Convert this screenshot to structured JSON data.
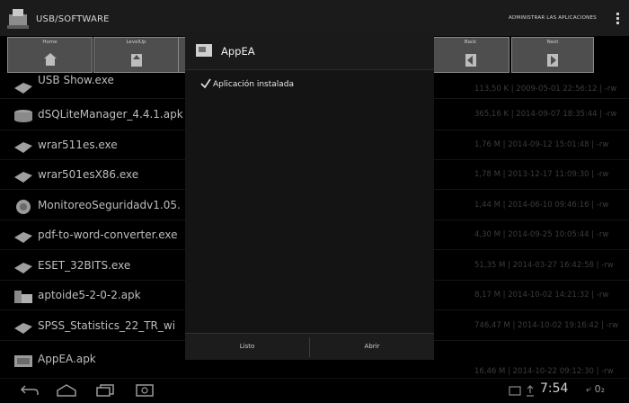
{
  "header": {
    "title": "USB/SOFTWARE",
    "manage_apps": "ADMINISTRAR LAS APLICACIONES"
  },
  "toolbar": {
    "home": "Home",
    "level_up": "LevelUp",
    "back": "Back",
    "next": "Next"
  },
  "files": [
    {
      "name": "USB Show.exe",
      "meta": "113,50 K | 2009-05-01 22:56:12 | -rw"
    },
    {
      "name": "dSQLiteManager_4.4.1.apk",
      "meta": "365,16 K | 2014-09-07 18:35:44 | -rw"
    },
    {
      "name": "wrar511es.exe",
      "meta": "1,76 M | 2014-09-12 15:01:48 | -rw"
    },
    {
      "name": "wrar501esX86.exe",
      "meta": "1,78 M | 2013-12-17 11:09:30 | -rw"
    },
    {
      "name": "MonitoreoSeguridadv1.05.",
      "meta": "1,44 M | 2014-06-10 09:46:16 | -rw"
    },
    {
      "name": "pdf-to-word-converter.exe",
      "meta": "4,30 M | 2014-09-25 10:05:44 | -rw"
    },
    {
      "name": "ESET_32BITS.exe",
      "meta": "51,35 M | 2014-03-27 16:42:58 | -rw"
    },
    {
      "name": "aptoide5-2-0-2.apk",
      "meta": "8,17 M | 2014-10-02 14:21:32 | -rw"
    },
    {
      "name": "SPSS_Statistics_22_TR_wi",
      "meta": "746,47 M | 2014-10-02 19:16:42 | -rw"
    },
    {
      "name": "AppEA.apk",
      "meta": "16,46 M | 2014-10-22 09:12:30 | -rw"
    }
  ],
  "dialog": {
    "title": "AppEA",
    "message": "Aplicación instalada",
    "done_label": "Listo",
    "open_label": "Abrir"
  },
  "status": {
    "time": "7:54",
    "signal": "⤶ 0₂"
  },
  "colors": {
    "background": "#000000",
    "toolbar_button": "#4e4e4e",
    "dialog": "#141414"
  }
}
